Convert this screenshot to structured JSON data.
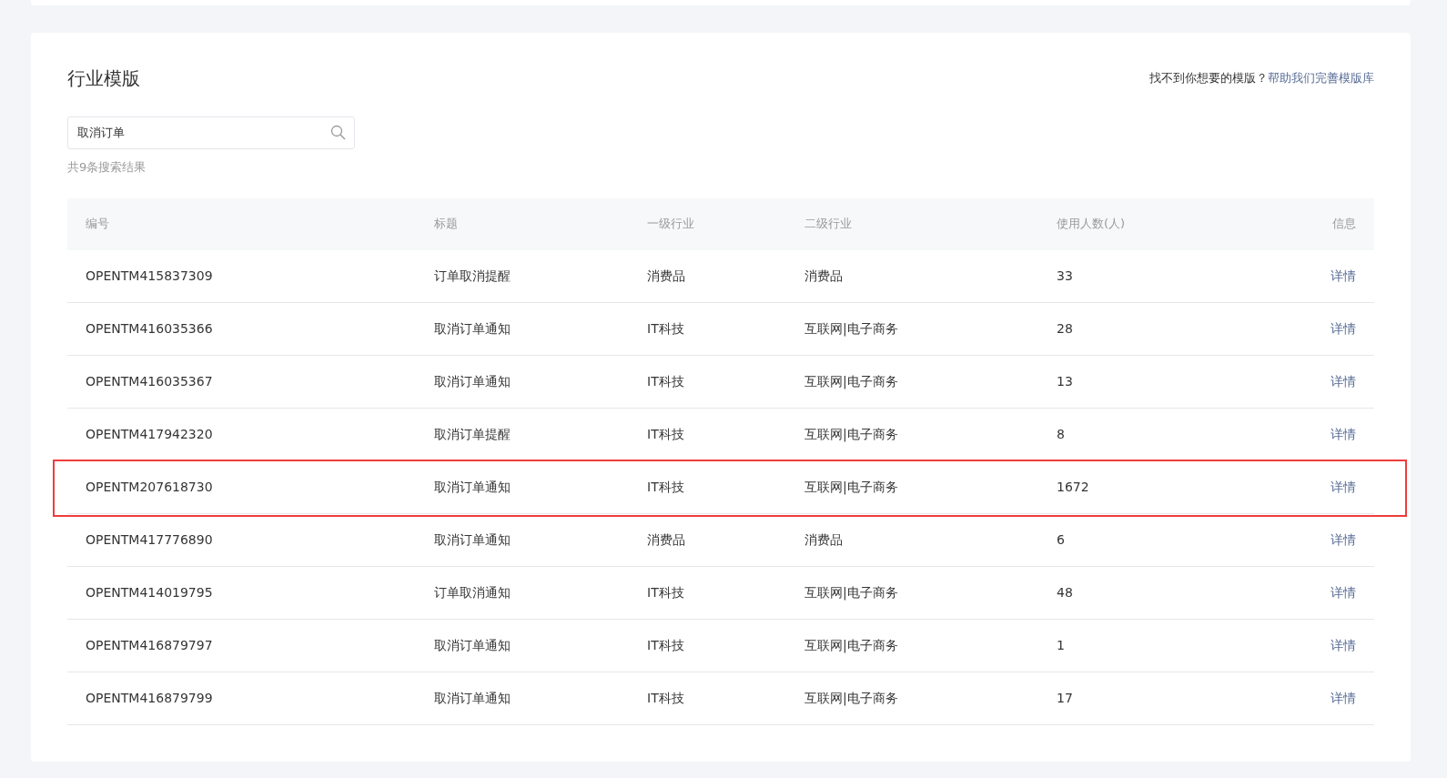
{
  "section": {
    "title": "行业模版",
    "help_text": "找不到你想要的模版？",
    "help_link": "帮助我们完善模版库"
  },
  "search": {
    "value": "取消订单"
  },
  "result_count": "共9条搜索结果",
  "table": {
    "columns": [
      "编号",
      "标题",
      "一级行业",
      "二级行业",
      "使用人数(人)",
      "信息"
    ],
    "rows": [
      {
        "cells": [
          "OPENTM415837309",
          "订单取消提醒",
          "消费品",
          "消费品",
          "33",
          "详情"
        ],
        "highlighted": false
      },
      {
        "cells": [
          "OPENTM416035366",
          "取消订单通知",
          "IT科技",
          "互联网|电子商务",
          "28",
          "详情"
        ],
        "highlighted": false
      },
      {
        "cells": [
          "OPENTM416035367",
          "取消订单通知",
          "IT科技",
          "互联网|电子商务",
          "13",
          "详情"
        ],
        "highlighted": false
      },
      {
        "cells": [
          "OPENTM417942320",
          "取消订单提醒",
          "IT科技",
          "互联网|电子商务",
          "8",
          "详情"
        ],
        "highlighted": false
      },
      {
        "cells": [
          "OPENTM207618730",
          "取消订单通知",
          "IT科技",
          "互联网|电子商务",
          "1672",
          "详情"
        ],
        "highlighted": true
      },
      {
        "cells": [
          "OPENTM417776890",
          "取消订单通知",
          "消费品",
          "消费品",
          "6",
          "详情"
        ],
        "highlighted": false
      },
      {
        "cells": [
          "OPENTM414019795",
          "订单取消通知",
          "IT科技",
          "互联网|电子商务",
          "48",
          "详情"
        ],
        "highlighted": false
      },
      {
        "cells": [
          "OPENTM416879797",
          "取消订单通知",
          "IT科技",
          "互联网|电子商务",
          "1",
          "详情"
        ],
        "highlighted": false
      },
      {
        "cells": [
          "OPENTM416879799",
          "取消订单通知",
          "IT科技",
          "互联网|电子商务",
          "17",
          "详情"
        ],
        "highlighted": false
      }
    ]
  }
}
